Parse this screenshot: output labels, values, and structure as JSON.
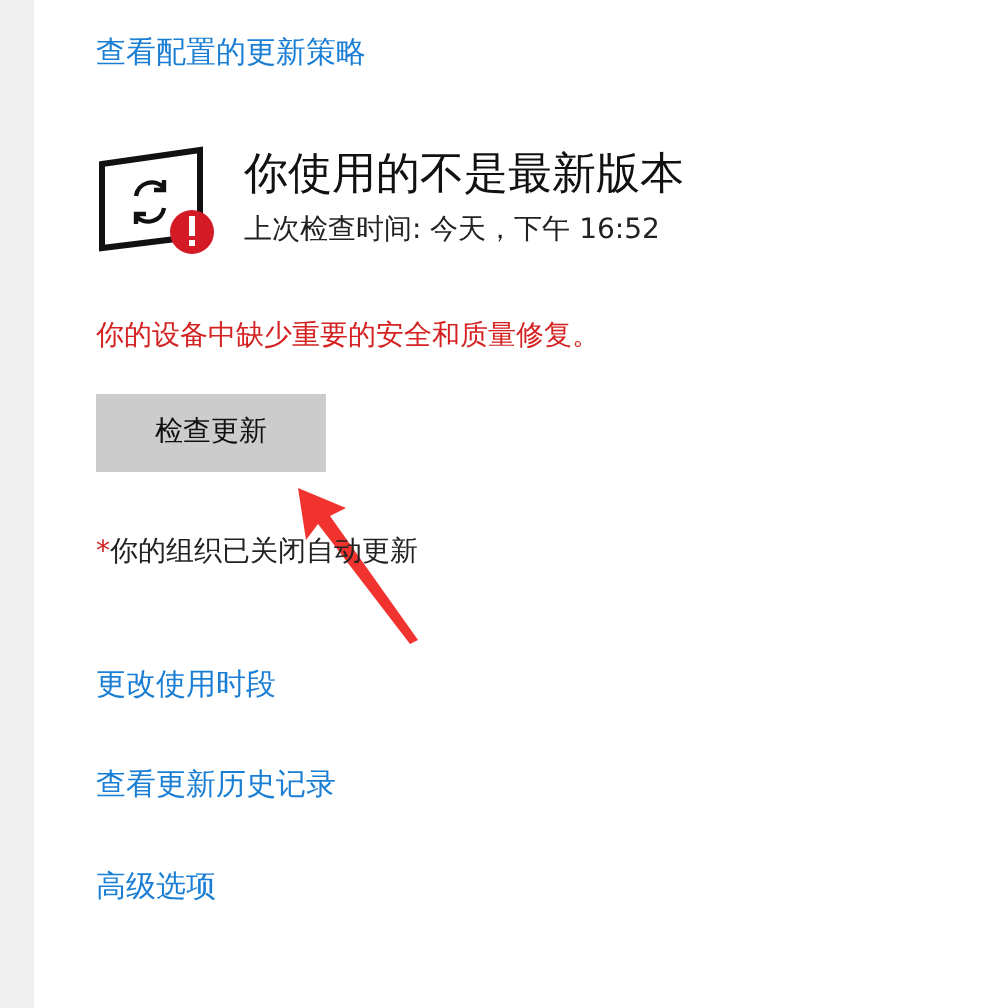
{
  "policy_link": "查看配置的更新策略",
  "status": {
    "title": "你使用的不是最新版本",
    "last_checked": "上次检查时间: 今天，下午 16:52"
  },
  "warning": "你的设备中缺少重要的安全和质量修复。",
  "check_button": "检查更新",
  "note": {
    "asterisk": "*",
    "text": "你的组织已关闭自动更新"
  },
  "links": [
    "更改使用时段",
    "查看更新历史记录",
    "高级选项"
  ],
  "annotation": {
    "kind": "arrow"
  }
}
